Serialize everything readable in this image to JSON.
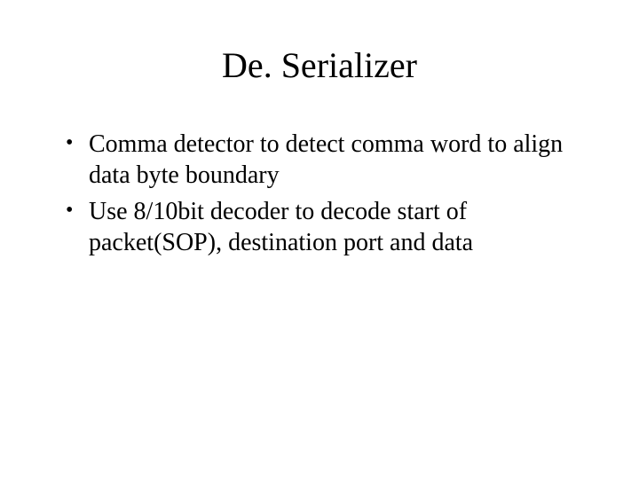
{
  "slide": {
    "title": "De. Serializer",
    "bullets": [
      "Comma detector to detect comma word to align data byte boundary",
      "Use 8/10bit decoder to decode start of packet(SOP), destination port and data"
    ]
  }
}
